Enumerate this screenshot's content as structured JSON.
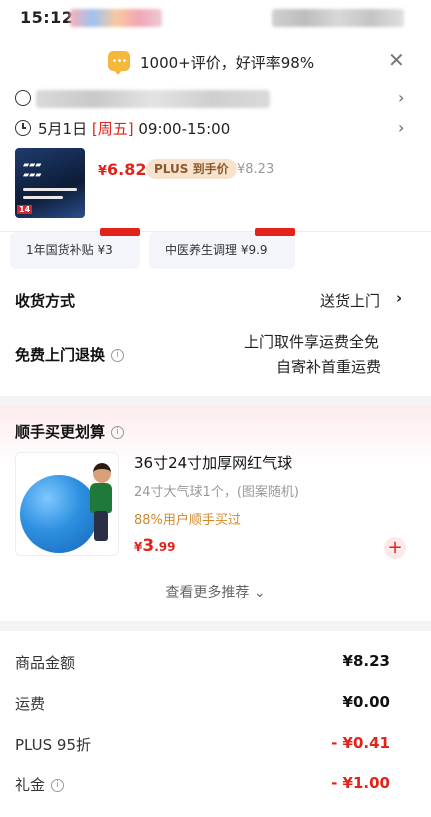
{
  "status_bar": {
    "time": "15:12"
  },
  "banner": {
    "text": "1000+评价，好评率98%",
    "close_icon": "close-icon"
  },
  "delivery": {
    "address_icon": "location-icon",
    "date": "5月1日",
    "weekday": "[周五]",
    "time_range": "09:00-15:00"
  },
  "product": {
    "price_yen": "¥",
    "price": "6.82",
    "plus_badge": "PLUS 到手价",
    "original_price": "¥8.23",
    "thumb_tag": "14"
  },
  "subsidies": [
    {
      "label": "1年国货补贴  ¥3"
    },
    {
      "label": "中医养生调理  ¥9.9"
    }
  ],
  "shipping": {
    "label": "收货方式",
    "value": "送货上门",
    "chevron": "›"
  },
  "returns": {
    "label": "免费上门退换",
    "line1": "上门取件享运费全免",
    "line2": "自寄补首重运费"
  },
  "recommend": {
    "title": "顺手买更划算",
    "item": {
      "name": "36寸24寸加厚网红气球",
      "desc": "24寸大气球1个，(图案随机)",
      "social": "88%用户顺手买过",
      "price_yen": "¥",
      "price_int": "3",
      "price_dec": ".99"
    },
    "more": "查看更多推荐 ⌄"
  },
  "fees": [
    {
      "label": "商品金额",
      "value": "¥8.23",
      "discount": false
    },
    {
      "label": "运费",
      "value": "¥0.00",
      "discount": false
    },
    {
      "label": "PLUS 95折",
      "value": "- ¥0.41",
      "discount": true
    },
    {
      "label": "礼金",
      "value": "- ¥1.00",
      "discount": true
    }
  ],
  "colors": {
    "accent": "#e2231a",
    "plus": "#f7e3cd",
    "social": "#d08a2c"
  }
}
